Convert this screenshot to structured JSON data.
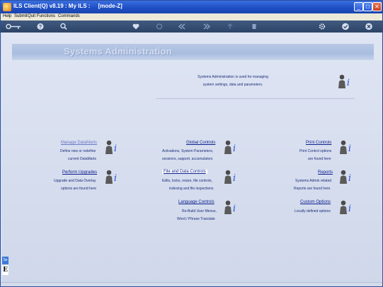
{
  "window": {
    "title": "ILS Client(Q) v8.19 : My ILS :     [mode-Z]"
  },
  "menu": [
    "Help",
    "Submit",
    "Quit",
    "Functions",
    "Commands"
  ],
  "toolbar": {
    "icons": [
      "key-icon",
      "help-icon",
      "search-icon",
      "heart-icon",
      "circle-icon",
      "rewind-icon",
      "fast-forward-icon",
      "up-arrow-icon",
      "page-icon",
      "settings-icon",
      "check-icon",
      "close-icon"
    ]
  },
  "banner": {
    "title": "Systems Administration"
  },
  "intro": {
    "line1": "Systems Administration is used for managing",
    "line2": "system settings, data and parameters."
  },
  "items": [
    {
      "link": "Manage DataMarts",
      "desc1": "Define new or redefine",
      "desc2": "current DataMarts"
    },
    {
      "link": "Global Controls",
      "desc1": "Activations, System Parameters,",
      "desc2": "sessions, support, accumulators"
    },
    {
      "link": "Print Controls",
      "desc1": "Print Control options",
      "desc2": "are found here"
    },
    {
      "link": "Perform Upgrades",
      "desc1": "Upgrade and Data Overlay",
      "desc2": "options are found here"
    },
    {
      "link": "File and Data Controls",
      "desc1": "Edits, locks, resize, file controls,",
      "desc2": "indexing and file inspections"
    },
    {
      "link": "Reports",
      "desc1": "Systems Admin related",
      "desc2": "Reports are found here"
    },
    {
      "link": "Language Controls",
      "desc1": "Re-Build User Menus,",
      "desc2": "Word / Phrase Translate"
    },
    {
      "link": "Custom Options",
      "desc1": "Locally defined options",
      "desc2": ""
    }
  ],
  "side": {
    "tab": "Se",
    "letter": "E"
  }
}
